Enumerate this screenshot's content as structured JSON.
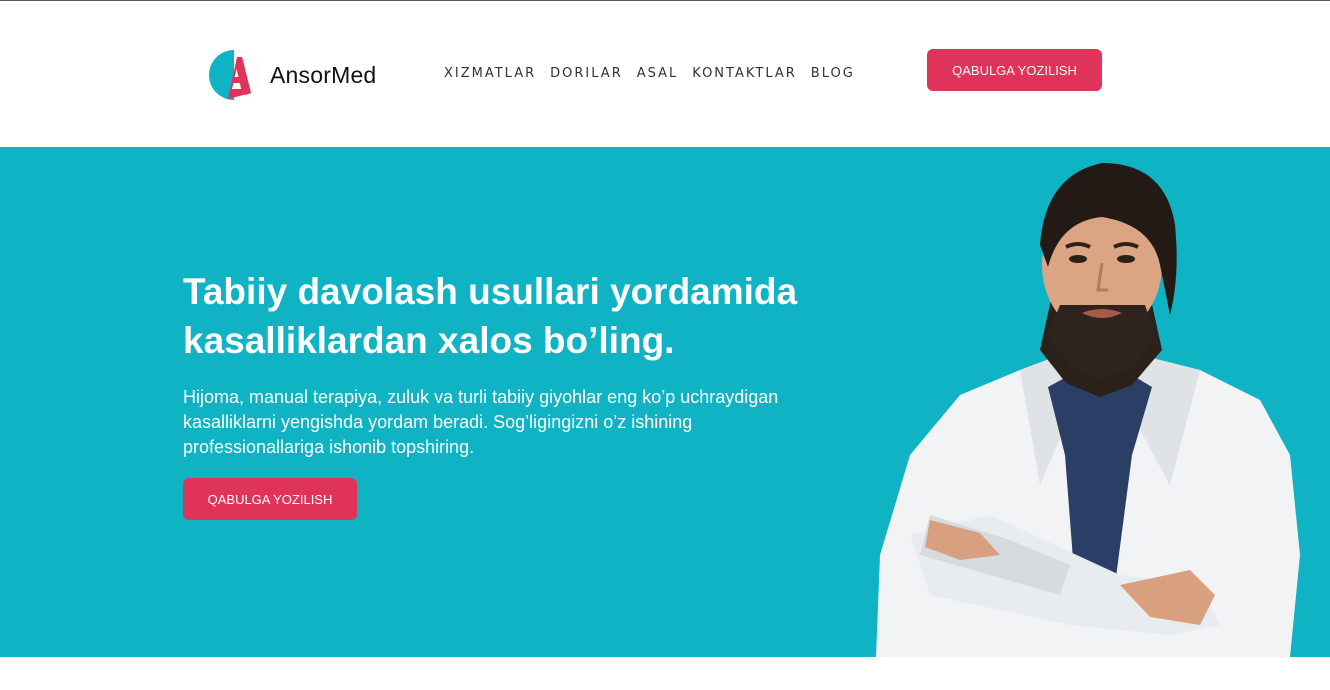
{
  "brand": {
    "name": "AnsorMed",
    "colors": {
      "teal": "#0fb3c4",
      "pink": "#e0335a"
    }
  },
  "nav": {
    "items": [
      {
        "label": "XIZMATLAR"
      },
      {
        "label": "DORILAR"
      },
      {
        "label": "ASAL"
      },
      {
        "label": "KONTAKTLAR"
      },
      {
        "label": "BLOG"
      }
    ]
  },
  "header": {
    "cta_label": "QABULGA YOZILISH"
  },
  "hero": {
    "title": "Tabiiy davolash usullari yordamida kasalliklardan xalos bo’ling.",
    "subtitle": "Hijoma, manual terapiya, zuluk va turli tabiiy giyohlar eng ko’p uchraydigan kasalliklarni yengishda yordam beradi. Sog’ligingizni o’z ishining professionallariga ishonib topshiring.",
    "cta_label": "QABULGA YOZILISH",
    "photo_icon": "doctor-portrait"
  }
}
